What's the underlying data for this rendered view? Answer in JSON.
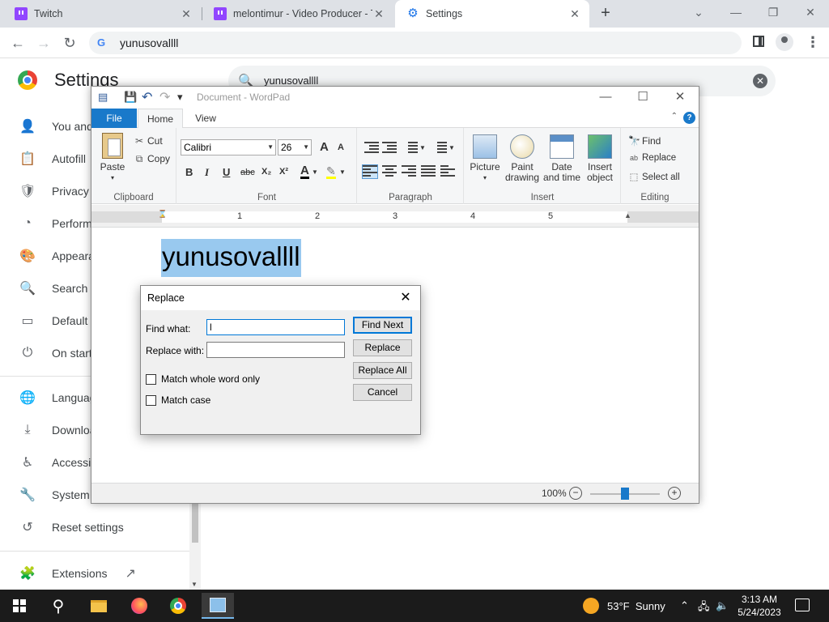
{
  "browser": {
    "tabs": [
      {
        "title": "Twitch"
      },
      {
        "title": "melontimur - Video Producer - T"
      },
      {
        "title": "Settings"
      }
    ],
    "close_glyph": "✕",
    "new_tab_glyph": "+",
    "window_controls": {
      "dropdown": "⌄",
      "minimize": "—",
      "restore": "❐",
      "close": "✕"
    },
    "nav": {
      "back": "←",
      "forward": "→",
      "reload": "↻",
      "menu": "⋮"
    },
    "address": "yunusovallll"
  },
  "settings": {
    "title": "Settings",
    "search_value": "yunusovallll",
    "search_icon": "search-icon",
    "clear_glyph": "✕",
    "nav": [
      {
        "label": "You and Google",
        "icon": "person-icon",
        "glyph": "👤"
      },
      {
        "label": "Autofill",
        "icon": "clipboard-icon",
        "glyph": "📋"
      },
      {
        "label": "Privacy and security",
        "icon": "shield-icon",
        "glyph": "🛡"
      },
      {
        "label": "Performance",
        "icon": "speedometer-icon",
        "glyph": "◔"
      },
      {
        "label": "Appearance",
        "icon": "palette-icon",
        "glyph": "🎨"
      },
      {
        "label": "Search engine",
        "icon": "search-icon",
        "glyph": "🔍"
      },
      {
        "label": "Default browser",
        "icon": "browser-icon",
        "glyph": "▭"
      },
      {
        "label": "On startup",
        "icon": "power-icon",
        "glyph": "⏻"
      },
      {
        "label": "Languages",
        "icon": "globe-icon",
        "glyph": "🌐"
      },
      {
        "label": "Downloads",
        "icon": "download-icon",
        "glyph": "⤓"
      },
      {
        "label": "Accessibility",
        "icon": "accessibility-icon",
        "glyph": "♿"
      },
      {
        "label": "System",
        "icon": "wrench-icon",
        "glyph": "🔧"
      },
      {
        "label": "Reset settings",
        "icon": "restore-icon",
        "glyph": "↺"
      },
      {
        "label": "Extensions",
        "icon": "puzzle-icon",
        "glyph": "🧩"
      }
    ],
    "extensions_link_glyph": "↗"
  },
  "wordpad": {
    "title": "Document - WordPad",
    "qat": {
      "app": "▤",
      "save": "💾",
      "undo": "↶",
      "redo": "↷",
      "more": "▾"
    },
    "window_controls": {
      "minimize": "—",
      "maximize": "☐",
      "close": "✕"
    },
    "tabs": {
      "file": "File",
      "home": "Home",
      "view": "View"
    },
    "help_glyph": "?",
    "collapse_glyph": "⌃",
    "clipboard": {
      "paste": "Paste",
      "cut": "Cut",
      "copy": "Copy",
      "group": "Clipboard",
      "cut_glyph": "✂",
      "copy_glyph": "⧉"
    },
    "font": {
      "family": "Calibri",
      "size": "26",
      "group": "Font",
      "grow": "A",
      "shrink": "A",
      "bold": "B",
      "italic": "I",
      "underline": "U",
      "strike": "abc",
      "subscript": "X₂",
      "superscript": "X²",
      "color": "A",
      "highlight": "✎"
    },
    "paragraph": {
      "group": "Paragraph"
    },
    "insert": {
      "picture": "Picture",
      "paint": "Paint drawing",
      "datetime": "Date and time",
      "object": "Insert object",
      "group": "Insert"
    },
    "editing": {
      "find": "Find",
      "replace": "Replace",
      "select_all": "Select all",
      "group": "Editing",
      "find_glyph": "🔭",
      "replace_glyph": "ab",
      "select_glyph": "⬚"
    },
    "ruler": {
      "numbers": [
        "1",
        "2",
        "3",
        "4",
        "5"
      ]
    },
    "document_text": "yunusovallll",
    "status": {
      "zoom": "100%",
      "zoom_fraction": 0.5,
      "minus": "−",
      "plus": "+"
    }
  },
  "replace_dialog": {
    "title": "Replace",
    "find_label": "Find what:",
    "find_value": "l",
    "replace_label": "Replace with:",
    "replace_value": "",
    "whole_word": "Match whole word only",
    "match_case": "Match case",
    "buttons": {
      "find_next": "Find Next",
      "replace": "Replace",
      "replace_all": "Replace All",
      "cancel": "Cancel"
    },
    "close_glyph": "✕"
  },
  "taskbar": {
    "weather_temp": "53°F",
    "weather_cond": "Sunny",
    "time": "3:13 AM",
    "date": "5/24/2023",
    "search_glyph": "⚲",
    "tray": {
      "chevron": "⌃",
      "network": "🖧",
      "volume": "🔈"
    }
  }
}
